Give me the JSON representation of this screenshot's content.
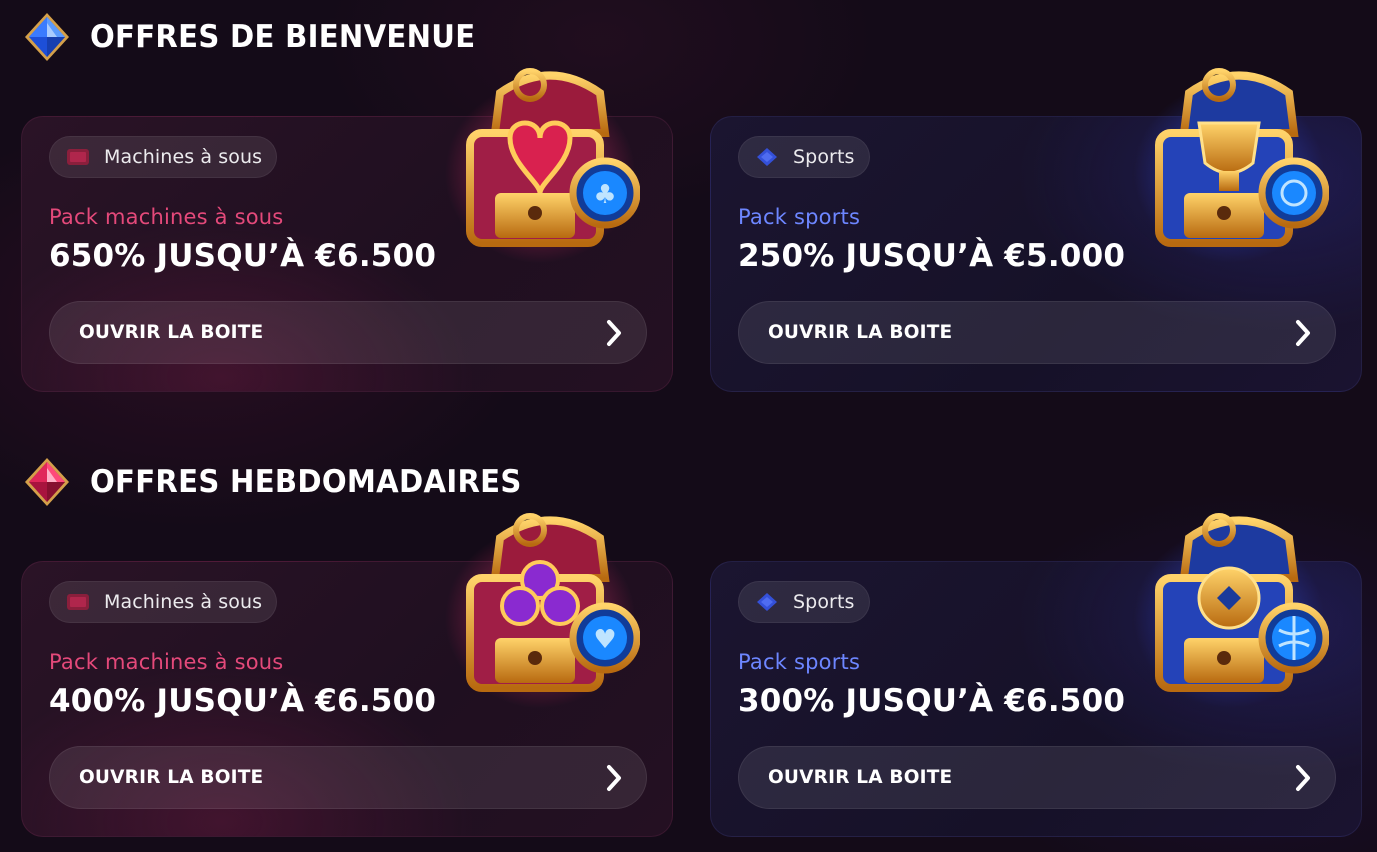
{
  "sections": [
    {
      "title": "OFFRES DE BIENVENUE",
      "gem_color": "#3a7bff",
      "cards": [
        {
          "theme": "pink",
          "tag": "Machines à sous",
          "subtitle": "Pack machines à sous",
          "amount": "650% JUSQU’À €6.500",
          "button": "OUVRIR LA BOITE",
          "chest_icon": "heart-chest-icon"
        },
        {
          "theme": "blue",
          "tag": "Sports",
          "subtitle": "Pack sports",
          "amount": "250% JUSQU’À €5.000",
          "button": "OUVRIR LA BOITE",
          "chest_icon": "trophy-chest-icon"
        }
      ]
    },
    {
      "title": "OFFRES HEBDOMADAIRES",
      "gem_color": "#e0285a",
      "cards": [
        {
          "theme": "pink",
          "tag": "Machines à sous",
          "subtitle": "Pack machines à sous",
          "amount": "400% JUSQU’À €6.500",
          "button": "OUVRIR LA BOITE",
          "chest_icon": "club-chest-icon"
        },
        {
          "theme": "blue",
          "tag": "Sports",
          "subtitle": "Pack sports",
          "amount": "300% JUSQU’À €6.500",
          "button": "OUVRIR LA BOITE",
          "chest_icon": "medal-chest-icon"
        }
      ]
    }
  ],
  "colors": {
    "background": "#140b18",
    "pink_accent": "#e4497a",
    "blue_accent": "#6d86ff",
    "gold": "#e8a020"
  }
}
